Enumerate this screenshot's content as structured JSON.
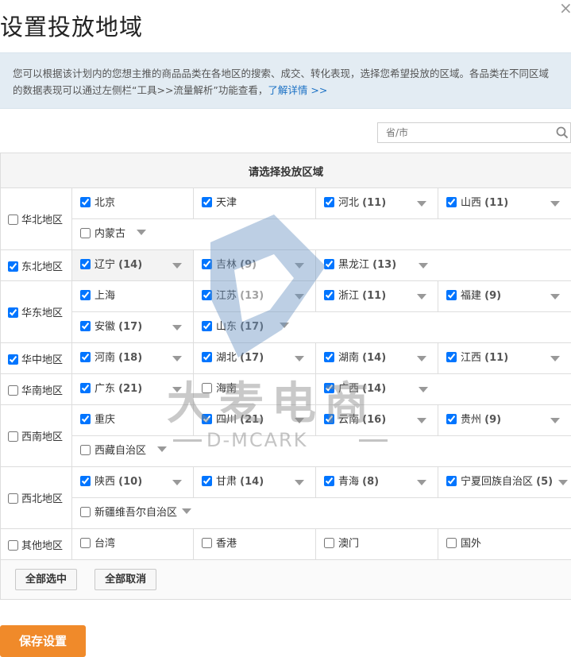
{
  "dialog": {
    "title": "设置投放地域",
    "close_label": "×"
  },
  "info": {
    "text": "您可以根据该计划内的您想主推的商品品类在各地区的搜索、成交、转化表现，选择您希望投放的区域。各品类在不同区域的数据表现可以通过左侧栏“工具>>流量解析”功能查看，",
    "link": "了解详情 >>"
  },
  "search": {
    "placeholder": "省/市"
  },
  "table": {
    "header": "请选择投放区域",
    "regions": [
      {
        "name": "华北地区",
        "checked": false,
        "provinces": [
          {
            "name": "北京",
            "count": "",
            "checked": true
          },
          {
            "name": "天津",
            "count": "",
            "checked": true
          },
          {
            "name": "河北",
            "count": "(11)",
            "checked": true
          },
          {
            "name": "山西",
            "count": "(11)",
            "checked": true
          },
          {
            "name": "内蒙古",
            "count": "",
            "checked": false
          }
        ]
      },
      {
        "name": "东北地区",
        "checked": true,
        "provinces": [
          {
            "name": "辽宁",
            "count": "(14)",
            "checked": true
          },
          {
            "name": "吉林",
            "count": "(9)",
            "checked": true
          },
          {
            "name": "黑龙江",
            "count": "(13)",
            "checked": true
          }
        ]
      },
      {
        "name": "华东地区",
        "checked": true,
        "provinces": [
          {
            "name": "上海",
            "count": "",
            "checked": true
          },
          {
            "name": "江苏",
            "count": "(13)",
            "checked": true
          },
          {
            "name": "浙江",
            "count": "(11)",
            "checked": true
          },
          {
            "name": "福建",
            "count": "(9)",
            "checked": true
          },
          {
            "name": "安徽",
            "count": "(17)",
            "checked": true
          },
          {
            "name": "山东",
            "count": "(17)",
            "checked": true
          }
        ]
      },
      {
        "name": "华中地区",
        "checked": true,
        "provinces": [
          {
            "name": "河南",
            "count": "(18)",
            "checked": true
          },
          {
            "name": "湖北",
            "count": "(17)",
            "checked": true
          },
          {
            "name": "湖南",
            "count": "(14)",
            "checked": true
          },
          {
            "name": "江西",
            "count": "(11)",
            "checked": true
          }
        ]
      },
      {
        "name": "华南地区",
        "checked": false,
        "provinces": [
          {
            "name": "广东",
            "count": "(21)",
            "checked": true
          },
          {
            "name": "海南",
            "count": "",
            "checked": false
          },
          {
            "name": "广西",
            "count": "(14)",
            "checked": true
          }
        ]
      },
      {
        "name": "西南地区",
        "checked": false,
        "provinces": [
          {
            "name": "重庆",
            "count": "",
            "checked": true
          },
          {
            "name": "四川",
            "count": "(21)",
            "checked": true
          },
          {
            "name": "云南",
            "count": "(16)",
            "checked": true
          },
          {
            "name": "贵州",
            "count": "(9)",
            "checked": true
          },
          {
            "name": "西藏自治区",
            "count": "",
            "checked": false
          }
        ]
      },
      {
        "name": "西北地区",
        "checked": false,
        "provinces": [
          {
            "name": "陕西",
            "count": "(10)",
            "checked": true
          },
          {
            "name": "甘肃",
            "count": "(14)",
            "checked": true
          },
          {
            "name": "青海",
            "count": "(8)",
            "checked": true
          },
          {
            "name": "宁夏回族自治区",
            "count": "(5)",
            "checked": true
          },
          {
            "name": "新疆维吾尔自治区",
            "count": "",
            "checked": false
          }
        ]
      },
      {
        "name": "其他地区",
        "checked": false,
        "provinces": [
          {
            "name": "台湾",
            "count": "",
            "checked": false
          },
          {
            "name": "香港",
            "count": "",
            "checked": false
          },
          {
            "name": "澳门",
            "count": "",
            "checked": false
          },
          {
            "name": "国外",
            "count": "",
            "checked": false
          }
        ]
      }
    ]
  },
  "buttons": {
    "select_all": "全部选中",
    "cancel_all": "全部取消",
    "save": "保存设置"
  },
  "watermark": {
    "cn": "大麦电商",
    "en": "D-MCARK"
  },
  "colors": {
    "accent": "#f08a2a",
    "info_bg": "#e3ecf3",
    "link": "#1a70c4"
  }
}
